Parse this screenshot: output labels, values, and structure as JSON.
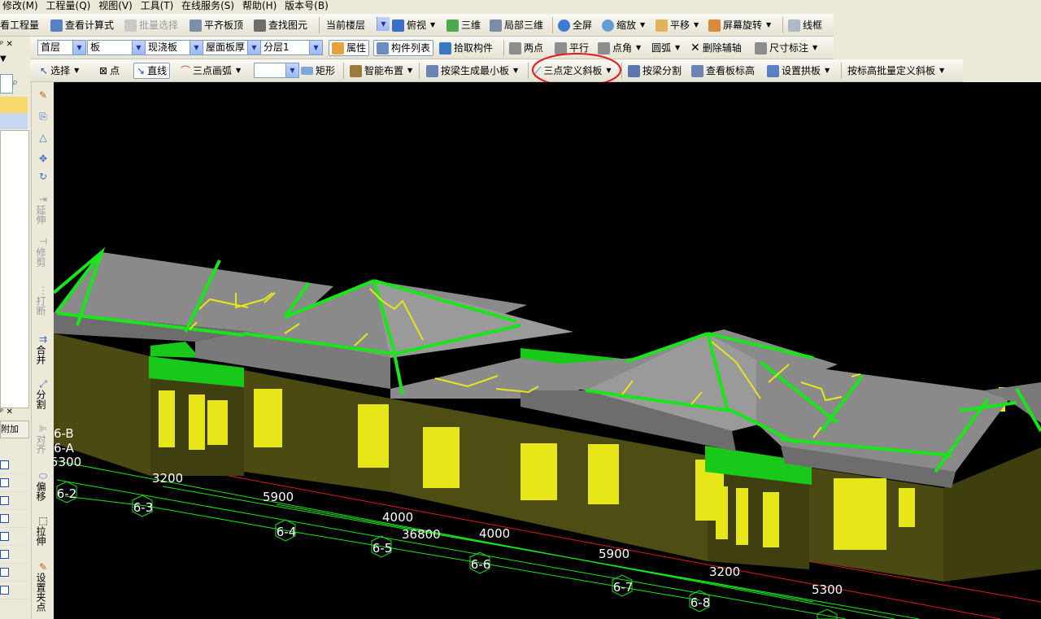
{
  "menu": [
    "修改(M)",
    "工程量(Q)",
    "视图(V)",
    "工具(T)",
    "在线服务(S)",
    "帮助(H)",
    "版本号(B)"
  ],
  "toolbar1": {
    "view_project": "看工程量",
    "view_formula": "查看计算式",
    "batch_select": "批量选择",
    "align_top": "平齐板顶",
    "find_element": "查找图元",
    "current_floor": "当前楼层",
    "top_view": "俯视",
    "three_d": "三维",
    "local_3d": "局部三维",
    "fullscreen": "全屏",
    "zoom": "缩放",
    "pan": "平移",
    "rotate": "屏幕旋转",
    "wireframe": "线框"
  },
  "toolbar2": {
    "floor": "首层",
    "category": "板",
    "type": "现浇板",
    "thickness": "屋面板厚",
    "layer": "分层1",
    "properties": "属性",
    "component_list": "构件列表",
    "pick_component": "拾取构件",
    "two_points": "两点",
    "parallel": "平行",
    "point_angle": "点角",
    "arc": "圆弧",
    "delete_aux": "删除辅轴",
    "dimension": "尺寸标注"
  },
  "toolbar3": {
    "select": "选择",
    "point": "点",
    "line": "直线",
    "three_point_arc": "三点画弧",
    "rect": "矩形",
    "smart_layout": "智能布置",
    "beam_min_slab": "按梁生成最小板",
    "three_point_slope": "三点定义斜板",
    "beam_split": "按梁分割",
    "view_slab_height": "查看板标高",
    "set_arch": "设置拱板",
    "elevation_batch_slope": "按标高批量定义斜板"
  },
  "side_tools": [
    "延伸",
    "修剪",
    "打断",
    "合并",
    "分割",
    "对齐",
    "偏移",
    "拉伸",
    "设置夹点"
  ],
  "left_panel": {
    "header": "附加"
  },
  "axis_labels": {
    "axes": [
      "6-2",
      "6-3",
      "6-4",
      "6-5",
      "6-6",
      "6-7",
      "6-8"
    ],
    "left_axes": [
      "6-B",
      "6-A"
    ],
    "dims": [
      "5300",
      "3200",
      "5900",
      "4000",
      "36800",
      "4000",
      "5900",
      "3200",
      "5300"
    ]
  },
  "colors": {
    "accent_circle": "#e01b1b",
    "roof": "#8a8a8a",
    "wall": "#4a4a12",
    "edge": "#19e619",
    "window": "#e6e619"
  }
}
